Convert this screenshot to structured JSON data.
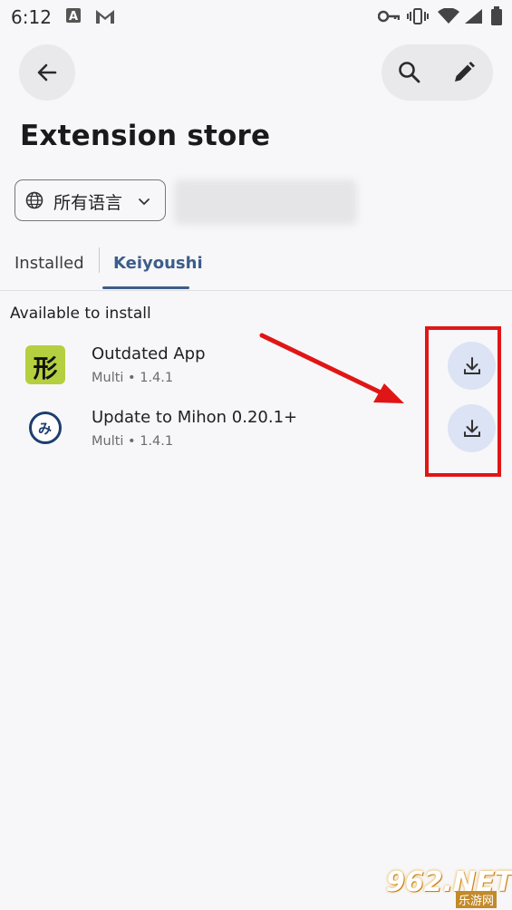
{
  "status_bar": {
    "time": "6:12",
    "icons": [
      "a-icon",
      "gmail-icon",
      "vpn-key-icon",
      "vibrate-icon",
      "wifi-icon",
      "signal-icon",
      "battery-icon"
    ]
  },
  "toolbar": {
    "back_icon": "arrow-back-icon",
    "search_icon": "search-icon",
    "edit_icon": "edit-icon"
  },
  "page": {
    "title": "Extension store"
  },
  "language_filter": {
    "label": "所有语言",
    "icon": "globe-icon",
    "chevron": "chevron-down-icon"
  },
  "tabs": [
    {
      "label": "Installed",
      "selected": false
    },
    {
      "label": "Keiyoushi",
      "selected": true
    }
  ],
  "section_header": "Available to install",
  "extensions": [
    {
      "name": "Outdated App",
      "meta": "Multi • 1.4.1",
      "icon_glyph": "形",
      "icon_bg": "#b4cf3f"
    },
    {
      "name": "Update to Mihon 0.20.1+",
      "meta": "Multi • 1.4.1",
      "icon_glyph": "み",
      "icon_bg": "#ffffff"
    }
  ],
  "colors": {
    "accent": "#3d5d8a",
    "download_button_bg": "#dbe3f4",
    "annotation_red": "#e01616"
  },
  "watermark": {
    "main": "962.NET",
    "sub": "乐游网"
  }
}
